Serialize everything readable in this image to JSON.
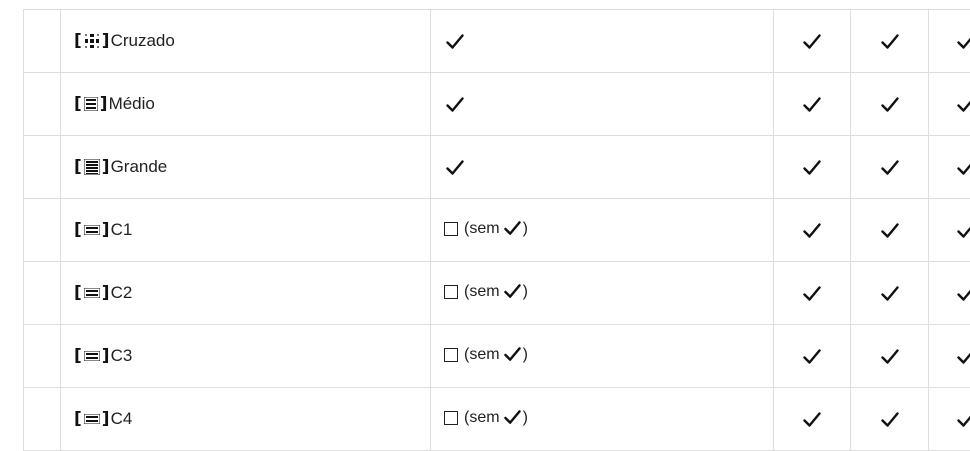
{
  "rows": [
    {
      "bracket_open": "[",
      "icon": "cross-pattern-icon",
      "label": "Cruzado",
      "bracket_close": "]",
      "main_checked": true,
      "main_text": "",
      "a_checked": true,
      "b_checked": true,
      "c_checked": true
    },
    {
      "bracket_open": "[",
      "icon": "medium-grid-icon",
      "label": "Médio",
      "bracket_close": "]",
      "main_checked": true,
      "main_text": "",
      "a_checked": true,
      "b_checked": true,
      "c_checked": true
    },
    {
      "bracket_open": "[",
      "icon": "large-grid-icon",
      "label": "Grande",
      "bracket_close": "]",
      "main_checked": true,
      "main_text": "",
      "a_checked": true,
      "b_checked": true,
      "c_checked": true
    },
    {
      "bracket_open": "[",
      "icon": "custom-grid-icon",
      "label": "C1",
      "bracket_close": "]",
      "main_checked": false,
      "main_text": "(sem",
      "paren_close": ")",
      "a_checked": true,
      "b_checked": true,
      "c_checked": true
    },
    {
      "bracket_open": "[",
      "icon": "custom-grid-icon",
      "label": "C2",
      "bracket_close": "]",
      "main_checked": false,
      "main_text": "(sem",
      "paren_close": ")",
      "a_checked": true,
      "b_checked": true,
      "c_checked": true
    },
    {
      "bracket_open": "[",
      "icon": "custom-grid-icon",
      "label": "C3",
      "bracket_close": "]",
      "main_checked": false,
      "main_text": "(sem",
      "paren_close": ")",
      "a_checked": true,
      "b_checked": true,
      "c_checked": true
    },
    {
      "bracket_open": "[",
      "icon": "custom-grid-icon",
      "label": "C4",
      "bracket_close": "]",
      "main_checked": false,
      "main_text": "(sem",
      "paren_close": ")",
      "a_checked": true,
      "b_checked": true,
      "c_checked": true
    }
  ],
  "colors": {
    "border": "#dddddd",
    "text": "#222222",
    "icon": "#111111"
  }
}
